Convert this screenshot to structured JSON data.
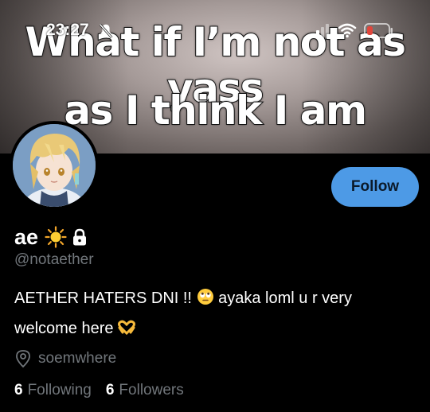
{
  "banner": {
    "caption_line1": "What if I’m not as yass",
    "caption_line2": "as I think I am"
  },
  "status_bar": {
    "time": "23:27",
    "icons": [
      "bell-slash-icon",
      "signal-icon",
      "wifi-icon",
      "battery-low-icon"
    ],
    "battery_color": "#e0463c"
  },
  "profile": {
    "display_name": "ae",
    "name_icons": [
      "sun-emoji-icon",
      "lock-icon"
    ],
    "handle": "@notaether",
    "bio_line1_before": "AETHER HATERS DNI !! ",
    "bio_line1_after": " ayaka loml u r very",
    "bio_line2": "welcome here ",
    "bio_emojis": [
      "eye-roll-emoji-icon",
      "heart-hands-emoji-icon"
    ],
    "location": "soemwhere",
    "following_count": "6",
    "following_label": "Following",
    "followers_count": "6",
    "followers_label": "Followers"
  },
  "actions": {
    "follow_label": "Follow"
  },
  "colors": {
    "accent": "#4d9ae6",
    "muted_text": "#71767b",
    "background": "#000000"
  }
}
